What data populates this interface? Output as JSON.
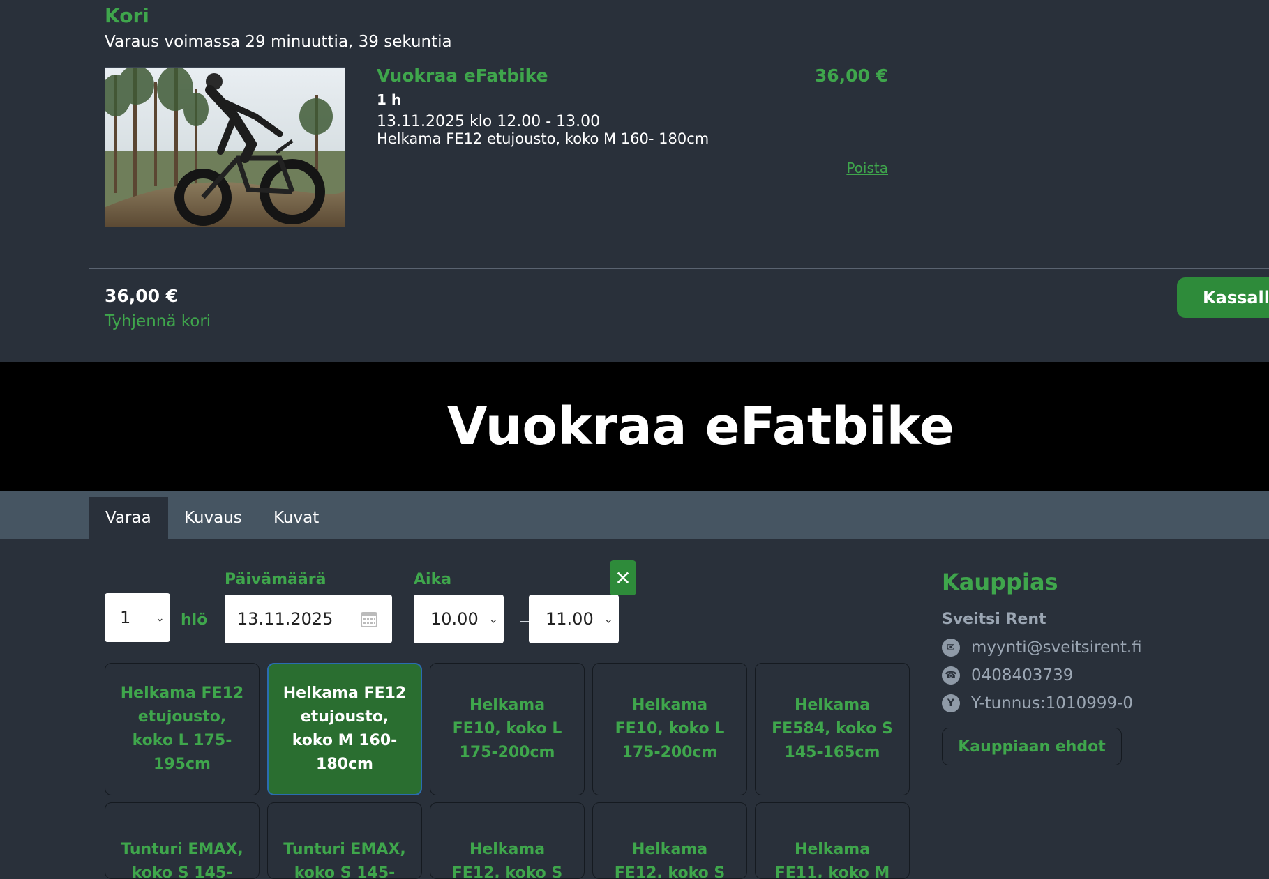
{
  "cart": {
    "title": "Kori",
    "reservation_timer": "Varaus voimassa 29 minuuttia, 39 sekuntia",
    "item": {
      "title": "Vuokraa eFatbike",
      "duration": "1 h",
      "datetime": "13.11.2025 klo 12.00 - 13.00",
      "variant": "Helkama FE12 etujousto, koko M 160- 180cm",
      "price": "36,00 €",
      "remove_label": "Poista"
    },
    "total": "36,00 €",
    "clear_label": "Tyhjennä kori",
    "checkout_label": "Kassalle"
  },
  "hero": {
    "title": "Vuokraa eFatbike"
  },
  "tabs": [
    {
      "label": "Varaa",
      "active": true
    },
    {
      "label": "Kuvaus",
      "active": false
    },
    {
      "label": "Kuvat",
      "active": false
    }
  ],
  "booking": {
    "persons_value": "1",
    "persons_unit": "hlö",
    "date_label": "Päivämäärä",
    "date_value": "13.11.2025",
    "time_label": "Aika",
    "time_start": "10.00",
    "time_end": "11.00",
    "bikes": [
      "Helkama FE12 etujousto, koko L 175-195cm",
      "Helkama FE12 etujousto, koko M 160-180cm",
      "Helkama FE10, koko L 175-200cm",
      "Helkama FE10, koko L 175-200cm",
      "Helkama FE584, koko S 145-165cm",
      "Tunturi EMAX, koko S 145-",
      "Tunturi EMAX, koko S 145-",
      "Helkama FE12, koko S",
      "Helkama FE12, koko S",
      "Helkama FE11, koko M"
    ],
    "selected_bike_index": 1
  },
  "merchant": {
    "title": "Kauppias",
    "name": "Sveitsi Rent",
    "email": "myynti@sveitsirent.fi",
    "phone": "0408403739",
    "business_id": "Y-tunnus:1010999-0",
    "terms_label": "Kauppiaan ehdot"
  },
  "colors": {
    "accent": "#3fa64c",
    "button": "#2e8b3a",
    "background": "#29303a",
    "tabbar": "#465562"
  }
}
